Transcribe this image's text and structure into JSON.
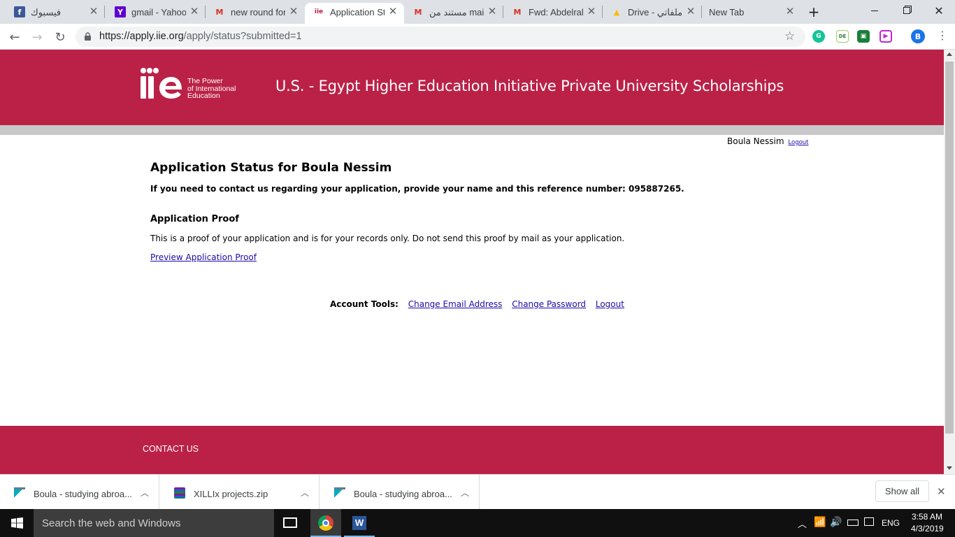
{
  "browser": {
    "tabs": [
      {
        "title": "فيسبوك",
        "favicon": "facebook-icon",
        "color": "#3b5998",
        "active": false
      },
      {
        "title": "gmail - Yahoo",
        "favicon": "yahoo-icon",
        "color": "#5f01d1",
        "active": false
      },
      {
        "title": "new round for",
        "favicon": "gmail-icon",
        "color": "#d93025",
        "active": false
      },
      {
        "title": "Application Sta",
        "favicon": "iie-icon",
        "color": "#bb2147",
        "active": true
      },
      {
        "title": "مستند من mail",
        "favicon": "gmail-icon",
        "color": "#d93025",
        "active": false
      },
      {
        "title": "Fwd: Abdelrah",
        "favicon": "gmail-icon",
        "color": "#d93025",
        "active": false
      },
      {
        "title": "Drive - ملفاتي",
        "favicon": "drive-icon",
        "color": "#fbbc04",
        "active": false
      },
      {
        "title": "New Tab",
        "favicon": "",
        "color": "",
        "active": false
      }
    ],
    "url_host": "https://apply.iie.org",
    "url_path": "/apply/status?submitted=1",
    "profile_initial": "B"
  },
  "header": {
    "logo_tagline_1": "The Power",
    "logo_tagline_2": "of International",
    "logo_tagline_3": "Education",
    "site_title": "U.S. - Egypt Higher Education Initiative Private University Scholarships",
    "brand_color": "#bb2147"
  },
  "user": {
    "name": "Boula Nessim",
    "logout_label": "Logout"
  },
  "main": {
    "heading": "Application Status for Boula Nessim",
    "contact_note": "If you need to contact us regarding your application, provide your name and this reference number: 095887265.",
    "proof_heading": "Application Proof",
    "proof_text": "This is a proof of your application and is for your records only. Do not send this proof by mail as your application.",
    "preview_link": "Preview Application Proof",
    "account_tools_label": "Account Tools:",
    "change_email": "Change Email Address",
    "change_password": "Change Password",
    "logout": "Logout"
  },
  "footer": {
    "contact_us": "CONTACT US"
  },
  "downloads": {
    "items": [
      {
        "name": "Boula - studying abroa...",
        "icon": "installer-icon"
      },
      {
        "name": "XILLIx projects.zip",
        "icon": "archive-icon"
      },
      {
        "name": "Boula - studying abroa...",
        "icon": "installer-icon"
      }
    ],
    "show_all": "Show all"
  },
  "taskbar": {
    "search_placeholder": "Search the web and Windows",
    "language": "ENG",
    "time": "3:58 AM",
    "date": "4/3/2019"
  }
}
